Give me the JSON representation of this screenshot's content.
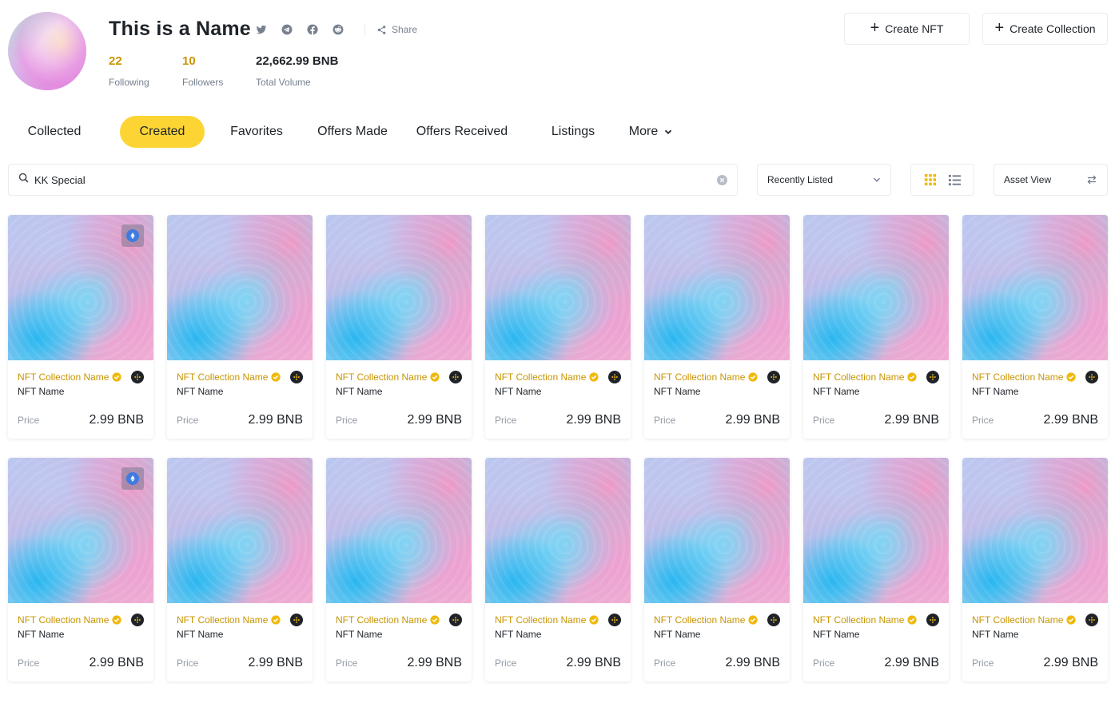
{
  "profile": {
    "name": "This is a Name",
    "share_label": "Share",
    "social_icons": [
      "twitter-icon",
      "telegram-icon",
      "facebook-icon",
      "reddit-icon"
    ],
    "stats": [
      {
        "value": "22",
        "label": "Following"
      },
      {
        "value": "10",
        "label": "Followers"
      },
      {
        "value": "22,662.99 BNB",
        "label": "Total Volume"
      }
    ]
  },
  "header_buttons": {
    "create_nft": "Create NFT",
    "create_collection": "Create Collection"
  },
  "tabs": [
    {
      "label": "Collected",
      "active": false
    },
    {
      "label": "Created",
      "active": true
    },
    {
      "label": "Favorites",
      "active": false
    },
    {
      "label": "Offers Made",
      "active": false
    },
    {
      "label": "Offers Received",
      "active": false
    },
    {
      "label": "Listings",
      "active": false
    },
    {
      "label": "More",
      "active": false
    }
  ],
  "filters": {
    "search_value": "KK Special",
    "sort_value": "Recently Listed",
    "asset_view_label": "Asset View",
    "view_mode": "grid"
  },
  "cards": [
    {
      "collection": "NFT Collection Name",
      "name": "NFT Name",
      "price_label": "Price",
      "price": "2.99 BNB",
      "badge": true
    },
    {
      "collection": "NFT Collection Name",
      "name": "NFT Name",
      "price_label": "Price",
      "price": "2.99 BNB",
      "badge": false
    },
    {
      "collection": "NFT Collection Name",
      "name": "NFT Name",
      "price_label": "Price",
      "price": "2.99 BNB",
      "badge": false
    },
    {
      "collection": "NFT Collection Name",
      "name": "NFT Name",
      "price_label": "Price",
      "price": "2.99 BNB",
      "badge": false
    },
    {
      "collection": "NFT Collection Name",
      "name": "NFT Name",
      "price_label": "Price",
      "price": "2.99 BNB",
      "badge": false
    },
    {
      "collection": "NFT Collection Name",
      "name": "NFT Name",
      "price_label": "Price",
      "price": "2.99 BNB",
      "badge": false
    },
    {
      "collection": "NFT Collection Name",
      "name": "NFT Name",
      "price_label": "Price",
      "price": "2.99 BNB",
      "badge": false
    },
    {
      "collection": "NFT Collection Name",
      "name": "NFT Name",
      "price_label": "Price",
      "price": "2.99 BNB",
      "badge": true
    },
    {
      "collection": "NFT Collection Name",
      "name": "NFT Name",
      "price_label": "Price",
      "price": "2.99 BNB",
      "badge": false
    },
    {
      "collection": "NFT Collection Name",
      "name": "NFT Name",
      "price_label": "Price",
      "price": "2.99 BNB",
      "badge": false
    },
    {
      "collection": "NFT Collection Name",
      "name": "NFT Name",
      "price_label": "Price",
      "price": "2.99 BNB",
      "badge": false
    },
    {
      "collection": "NFT Collection Name",
      "name": "NFT Name",
      "price_label": "Price",
      "price": "2.99 BNB",
      "badge": false
    },
    {
      "collection": "NFT Collection Name",
      "name": "NFT Name",
      "price_label": "Price",
      "price": "2.99 BNB",
      "badge": false
    },
    {
      "collection": "NFT Collection Name",
      "name": "NFT Name",
      "price_label": "Price",
      "price": "2.99 BNB",
      "badge": false
    }
  ],
  "colors": {
    "accent": "#fcd535",
    "gold_text": "#c99400",
    "text_primary": "#1e2329",
    "text_secondary": "#76808f"
  }
}
